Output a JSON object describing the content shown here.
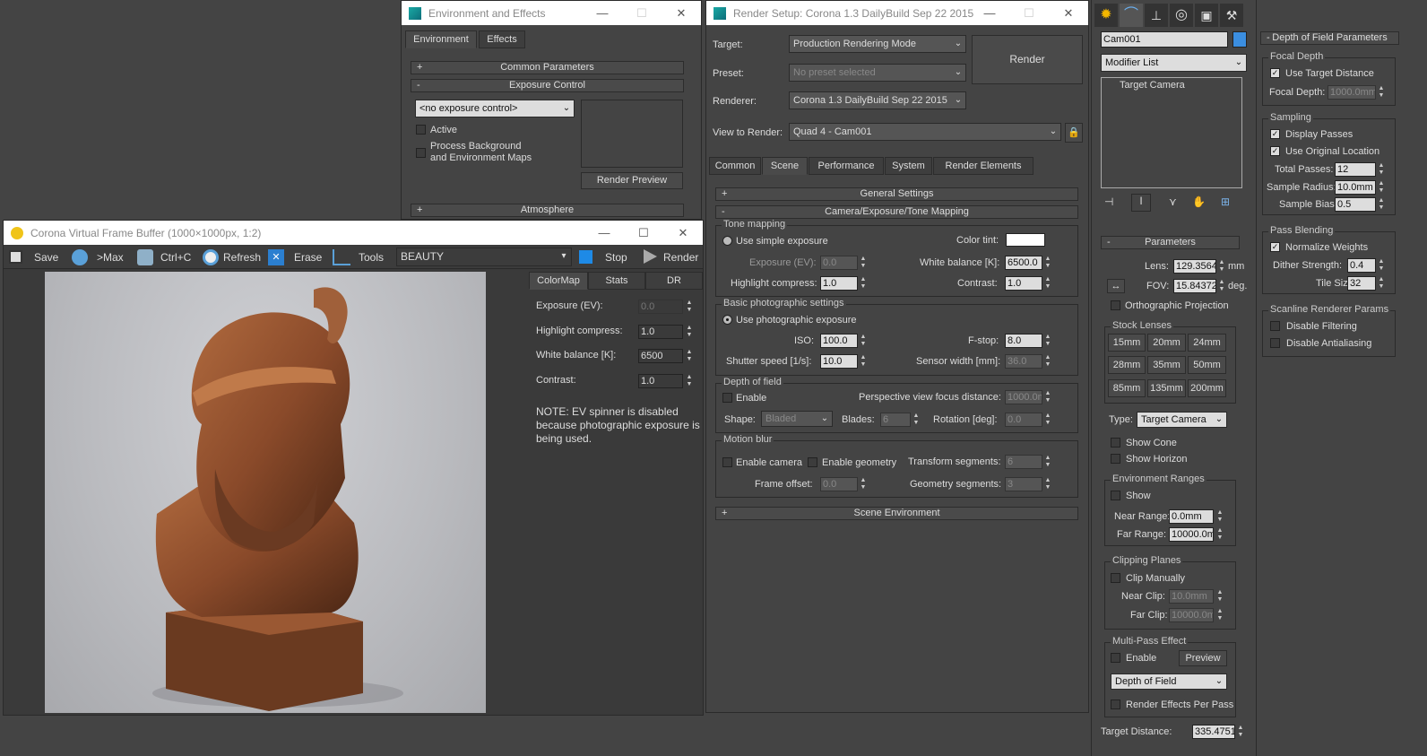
{
  "env_window": {
    "title": "Environment and Effects",
    "tabs": [
      "Environment",
      "Effects"
    ],
    "rollouts": {
      "common": "Common Parameters",
      "exposure": "Exposure Control",
      "atmosphere": "Atmosphere"
    },
    "exposure_dropdown": "<no exposure control>",
    "active_label": "Active",
    "process_bg_label": "Process Background",
    "process_bg_label2": "and Environment Maps",
    "render_preview": "Render Preview"
  },
  "vfb": {
    "title": "Corona Virtual Frame Buffer (1000×1000px, 1:2)",
    "toolbar": {
      "save": "Save",
      "max": ">Max",
      "ctrlc": "Ctrl+C",
      "refresh": "Refresh",
      "erase": "Erase",
      "tools": "Tools",
      "channel": "BEAUTY",
      "stop": "Stop",
      "render": "Render"
    },
    "tabs": [
      "ColorMap",
      "Stats",
      "DR"
    ],
    "fields": [
      {
        "label": "Exposure (EV):",
        "value": "0.0"
      },
      {
        "label": "Highlight compress:",
        "value": "1.0"
      },
      {
        "label": "White balance [K]:",
        "value": "6500"
      },
      {
        "label": "Contrast:",
        "value": "1.0"
      }
    ],
    "note": "NOTE: EV spinner is disabled because photographic exposure is being used."
  },
  "render_setup": {
    "title": "Render Setup: Corona 1.3 DailyBuild Sep 22 2015",
    "target_label": "Target:",
    "target_value": "Production Rendering Mode",
    "preset_label": "Preset:",
    "preset_value": "No preset selected",
    "renderer_label": "Renderer:",
    "renderer_value": "Corona 1.3 DailyBuild Sep 22 2015",
    "view_label": "View to Render:",
    "view_value": "Quad 4 - Cam001",
    "render_button": "Render",
    "tabs": [
      "Common",
      "Scene",
      "Performance",
      "System",
      "Render Elements"
    ],
    "rollouts": {
      "general": "General Settings",
      "camera": "Camera/Exposure/Tone Mapping",
      "scene_env": "Scene Environment"
    },
    "tone": {
      "title": "Tone mapping",
      "simple": "Use simple exposure",
      "color_tint": "Color tint:",
      "exposure_label": "Exposure (EV):",
      "exposure_value": "0.0",
      "wb_label": "White balance [K]:",
      "wb_value": "6500.0",
      "hl_label": "Highlight compress:",
      "hl_value": "1.0",
      "contrast_label": "Contrast:",
      "contrast_value": "1.0"
    },
    "photo": {
      "title": "Basic photographic settings",
      "use": "Use photographic exposure",
      "iso_label": "ISO:",
      "iso_value": "100.0",
      "fstop_label": "F-stop:",
      "fstop_value": "8.0",
      "shutter_label": "Shutter speed [1/s]:",
      "shutter_value": "10.0",
      "sensor_label": "Sensor width [mm]:",
      "sensor_value": "36.0"
    },
    "dof": {
      "title": "Depth of field",
      "enable": "Enable",
      "focus_label": "Perspective view focus distance:",
      "focus_value": "1000.0m",
      "shape_label": "Shape:",
      "shape_value": "Bladed",
      "blades_label": "Blades:",
      "blades_value": "6",
      "rotation_label": "Rotation [deg]:",
      "rotation_value": "0.0"
    },
    "mb": {
      "title": "Motion blur",
      "camera": "Enable camera",
      "geometry": "Enable geometry",
      "transform_label": "Transform segments:",
      "transform_value": "6",
      "offset_label": "Frame offset:",
      "offset_value": "0.0",
      "geomseg_label": "Geometry segments:",
      "geomseg_value": "3"
    }
  },
  "modify": {
    "object_name": "Cam001",
    "modifier_list": "Modifier List",
    "stack_item": "Target Camera",
    "params_rollout": "Parameters",
    "lens_label": "Lens:",
    "lens_value": "129.3564",
    "lens_unit": "mm",
    "fov_label": "FOV:",
    "fov_value": "15.84372",
    "fov_unit": "deg.",
    "ortho": "Orthographic Projection",
    "stock_lenses": "Stock Lenses",
    "lenses": [
      "15mm",
      "20mm",
      "24mm",
      "28mm",
      "35mm",
      "50mm",
      "85mm",
      "135mm",
      "200mm"
    ],
    "type_label": "Type:",
    "type_value": "Target Camera",
    "show_cone": "Show Cone",
    "show_horizon": "Show Horizon",
    "env_ranges": "Environment Ranges",
    "show": "Show",
    "near_range_label": "Near Range:",
    "near_range_value": "0.0mm",
    "far_range_label": "Far Range:",
    "far_range_value": "10000.0m",
    "clipping": "Clipping Planes",
    "clip_manually": "Clip Manually",
    "near_clip_label": "Near Clip:",
    "near_clip_value": "10.0mm",
    "far_clip_label": "Far Clip:",
    "far_clip_value": "10000.0m",
    "multipass": "Multi-Pass Effect",
    "mp_enable": "Enable",
    "preview": "Preview",
    "mp_effect": "Depth of Field",
    "render_effects": "Render Effects Per Pass",
    "target_distance_label": "Target Distance:",
    "target_distance_value": "335.4751"
  },
  "dof_params": {
    "rollout": "Depth of Field Parameters",
    "focal_depth": "Focal Depth",
    "use_target": "Use Target Distance",
    "focal_depth_label": "Focal Depth:",
    "focal_depth_value": "1000.0mm",
    "sampling": "Sampling",
    "display_passes": "Display Passes",
    "use_original": "Use Original Location",
    "total_passes_label": "Total Passes:",
    "total_passes_value": "12",
    "sample_radius_label": "Sample Radius:",
    "sample_radius_value": "10.0mm",
    "sample_bias_label": "Sample Bias:",
    "sample_bias_value": "0.5",
    "pass_blending": "Pass Blending",
    "normalize": "Normalize Weights",
    "dither_label": "Dither Strength:",
    "dither_value": "0.4",
    "tile_label": "Tile Size:",
    "tile_value": "32",
    "scanline": "Scanline Renderer Params",
    "disable_filtering": "Disable Filtering",
    "disable_aa": "Disable Antialiasing"
  },
  "colors": {
    "accent_blue": "#3b8ee0",
    "dark_bg": "#444444"
  }
}
